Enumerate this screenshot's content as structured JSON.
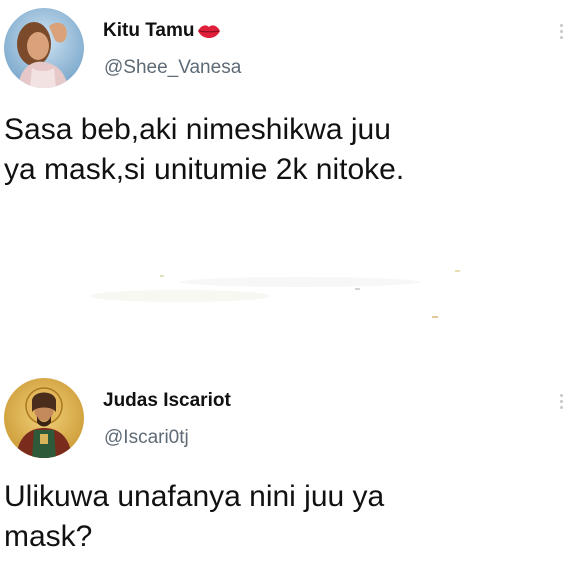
{
  "tweets": [
    {
      "display_name": "Kitu Tamu",
      "name_emoji": "lips-icon",
      "handle": "@Shee_Vanesa",
      "text_line_1": "Sasa beb,aki nimeshikwa juu",
      "text_line_2": "ya mask,si unitumie 2k nitoke.",
      "avatar": "avatar-woman-photo"
    },
    {
      "display_name": "Judas Iscariot",
      "handle": "@Iscari0tj",
      "text_line_1": "Ulikuwa unafanya nini juu ya",
      "text_line_2": "mask?",
      "avatar": "avatar-icon-painting"
    }
  ],
  "colors": {
    "text": "#111111",
    "handle": "#5e6b76",
    "lips": "#e0203a",
    "background": "#ffffff"
  }
}
